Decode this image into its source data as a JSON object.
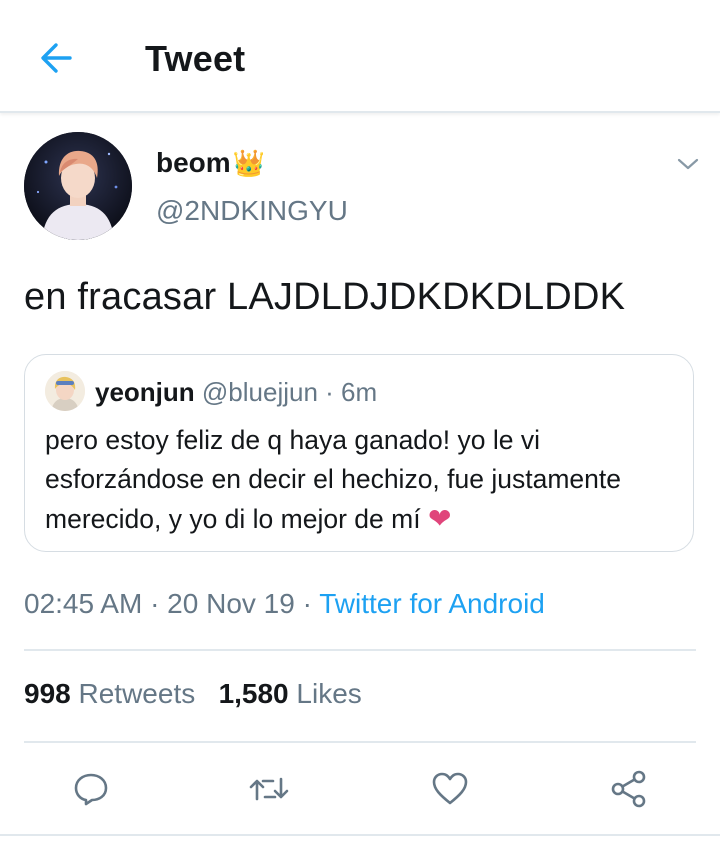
{
  "header": {
    "title": "Tweet",
    "back_icon": "arrow-left-icon"
  },
  "tweet": {
    "display_name": "beom",
    "name_emoji": "👑",
    "handle": "@2NDKINGYU",
    "text": "en fracasar LAJDLDJDKDKDLDDK",
    "timestamp": "02:45 AM · 20 Nov 19 · ",
    "source": "Twitter for Android"
  },
  "quote": {
    "name": "yeonjun",
    "handle_time": "@bluejjun · 6m",
    "text": "pero estoy feliz de q haya ganado! yo le vi esforzándose en decir el hechizo, fue justamente merecido, y yo di lo mejor de mí",
    "emoji": "❤"
  },
  "stats": {
    "retweets_count": "998",
    "retweets_label": "Retweets",
    "likes_count": "1,580",
    "likes_label": "Likes"
  },
  "actions": [
    "reply-icon",
    "retweet-icon",
    "like-icon",
    "share-icon"
  ],
  "colors": {
    "accent": "#1da1f2",
    "text": "#14171a",
    "muted": "#657786",
    "border": "#e1e8ed",
    "heart": "#e0457b"
  }
}
